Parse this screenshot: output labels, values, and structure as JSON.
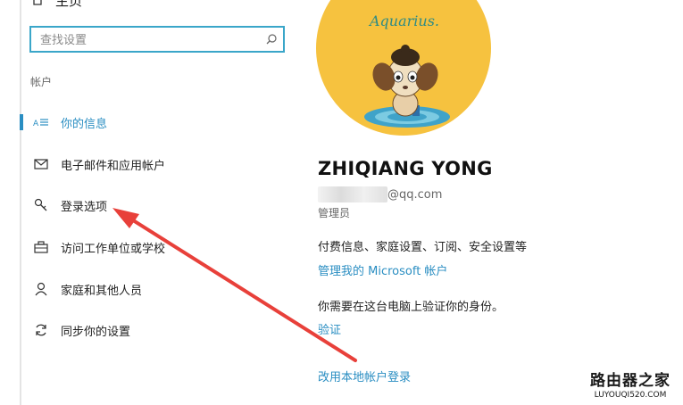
{
  "sidebar": {
    "home_label": "主页",
    "search": {
      "placeholder": "查找设置"
    },
    "section_label": "帐户",
    "items": [
      {
        "label": "你的信息",
        "icon": "id-card-icon",
        "active": true
      },
      {
        "label": "电子邮件和应用帐户",
        "icon": "mail-icon",
        "active": false
      },
      {
        "label": "登录选项",
        "icon": "key-icon",
        "active": false
      },
      {
        "label": "访问工作单位或学校",
        "icon": "briefcase-icon",
        "active": false
      },
      {
        "label": "家庭和其他人员",
        "icon": "person-icon",
        "active": false
      },
      {
        "label": "同步你的设置",
        "icon": "sync-icon",
        "active": false
      }
    ]
  },
  "profile": {
    "avatar_brand": "Aquarius.",
    "name": "ZHIQIANG YONG",
    "email_domain": "@qq.com",
    "role": "管理员",
    "billing_text": "付费信息、家庭设置、订阅、安全设置等",
    "manage_link": "管理我的 Microsoft 帐户",
    "verify_text": "你需要在这台电脑上验证你的身份。",
    "verify_link": "验证",
    "local_login_link": "改用本地帐户登录"
  },
  "watermark": {
    "line1": "路由器之家",
    "line2": "LUYOUQI520.COM"
  },
  "colors": {
    "accent": "#2a8ec2",
    "avatar_bg": "#f6c23f",
    "arrow": "#e8403a"
  }
}
